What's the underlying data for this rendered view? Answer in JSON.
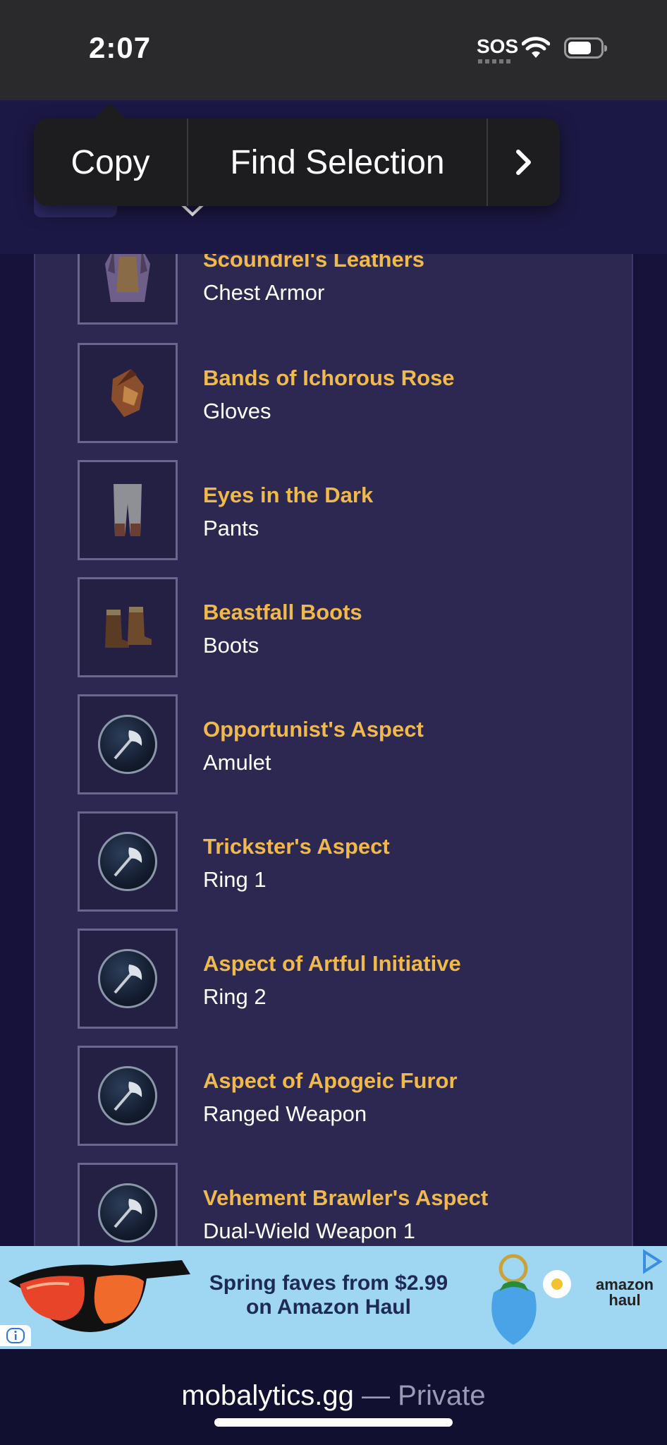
{
  "status_bar": {
    "time": "2:07",
    "sos": "SOS"
  },
  "context_menu": {
    "items": [
      "Copy",
      "Find Selection"
    ],
    "more_icon": "chevron-right-icon"
  },
  "items": [
    {
      "name": "Scoundrel's Leathers",
      "slot": "Chest Armor",
      "icon": "chest-armor-icon"
    },
    {
      "name": "Bands of Ichorous Rose",
      "slot": "Gloves",
      "icon": "gloves-icon"
    },
    {
      "name": "Eyes in the Dark",
      "slot": "Pants",
      "icon": "pants-icon"
    },
    {
      "name": "Beastfall Boots",
      "slot": "Boots",
      "icon": "boots-icon"
    },
    {
      "name": "Opportunist's Aspect",
      "slot": "Amulet",
      "icon": "aspect-axe-icon"
    },
    {
      "name": "Trickster's Aspect",
      "slot": "Ring 1",
      "icon": "aspect-axe-icon"
    },
    {
      "name": "Aspect of Artful Initiative",
      "slot": "Ring 2",
      "icon": "aspect-axe-icon"
    },
    {
      "name": "Aspect of Apogeic Furor",
      "slot": "Ranged Weapon",
      "icon": "aspect-axe-icon"
    },
    {
      "name": "Vehement Brawler's Aspect",
      "slot": "Dual-Wield Weapon 1",
      "icon": "aspect-axe-icon"
    }
  ],
  "ad": {
    "headline_line1": "Spring faves from $2.99",
    "headline_line2": "on Amazon Haul",
    "brand_line1": "amazon",
    "brand_line2": "haul"
  },
  "browser": {
    "domain": "mobalytics.gg",
    "mode": " — Private"
  },
  "colors": {
    "item_name": "#f0b94b",
    "panel_bg": "#2c2851",
    "page_bg": "#16123a"
  }
}
